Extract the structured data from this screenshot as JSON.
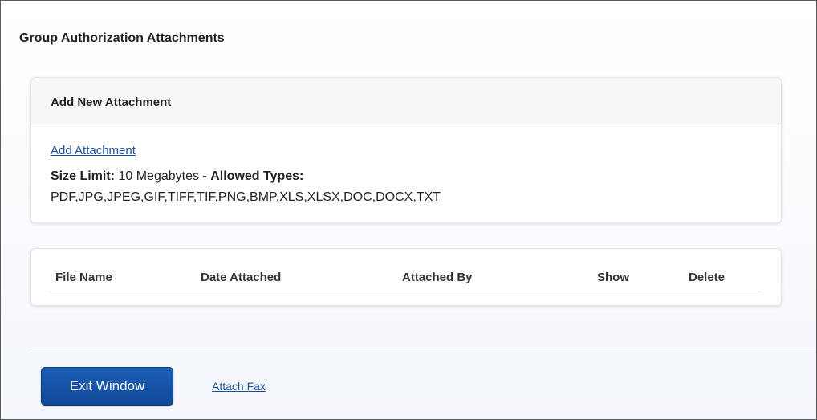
{
  "page": {
    "title": "Group Authorization Attachments"
  },
  "add_section": {
    "header": "Add New Attachment",
    "add_link": "Add Attachment",
    "size_limit_label": "Size Limit:",
    "size_limit_value": "10 Megabytes",
    "separator": "-",
    "allowed_types_label": "Allowed Types:",
    "allowed_types_value": "PDF,JPG,JPEG,GIF,TIFF,TIF,PNG,BMP,XLS,XLSX,DOC,DOCX,TXT"
  },
  "attachments_table": {
    "columns": [
      "File Name",
      "Date Attached",
      "Attached By",
      "Show",
      "Delete"
    ]
  },
  "footer": {
    "exit_label": "Exit Window",
    "fax_link": "Attach Fax"
  },
  "colors": {
    "primary_button": "#1c5db6",
    "link": "#1a4f9c",
    "header_bg": "#f6f7f9"
  }
}
